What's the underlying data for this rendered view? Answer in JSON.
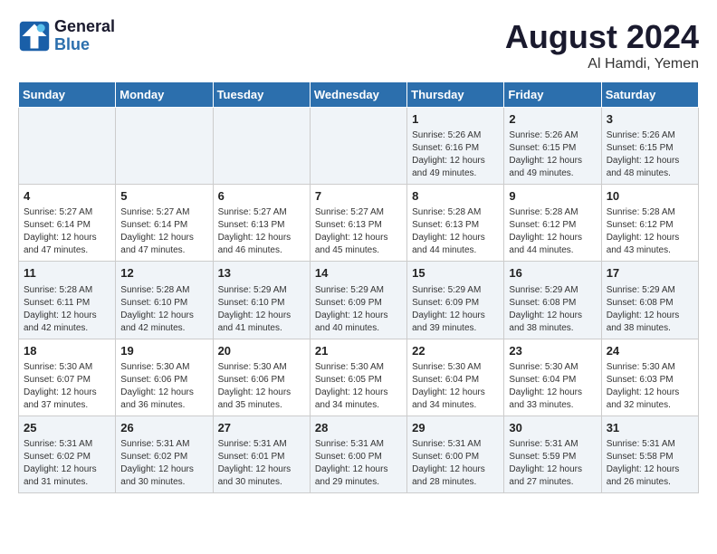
{
  "header": {
    "logo_line1": "General",
    "logo_line2": "Blue",
    "month_year": "August 2024",
    "location": "Al Hamdi, Yemen"
  },
  "days_of_week": [
    "Sunday",
    "Monday",
    "Tuesday",
    "Wednesday",
    "Thursday",
    "Friday",
    "Saturday"
  ],
  "weeks": [
    [
      {
        "day": "",
        "content": ""
      },
      {
        "day": "",
        "content": ""
      },
      {
        "day": "",
        "content": ""
      },
      {
        "day": "",
        "content": ""
      },
      {
        "day": "1",
        "content": "Sunrise: 5:26 AM\nSunset: 6:16 PM\nDaylight: 12 hours\nand 49 minutes."
      },
      {
        "day": "2",
        "content": "Sunrise: 5:26 AM\nSunset: 6:15 PM\nDaylight: 12 hours\nand 49 minutes."
      },
      {
        "day": "3",
        "content": "Sunrise: 5:26 AM\nSunset: 6:15 PM\nDaylight: 12 hours\nand 48 minutes."
      }
    ],
    [
      {
        "day": "4",
        "content": "Sunrise: 5:27 AM\nSunset: 6:14 PM\nDaylight: 12 hours\nand 47 minutes."
      },
      {
        "day": "5",
        "content": "Sunrise: 5:27 AM\nSunset: 6:14 PM\nDaylight: 12 hours\nand 47 minutes."
      },
      {
        "day": "6",
        "content": "Sunrise: 5:27 AM\nSunset: 6:13 PM\nDaylight: 12 hours\nand 46 minutes."
      },
      {
        "day": "7",
        "content": "Sunrise: 5:27 AM\nSunset: 6:13 PM\nDaylight: 12 hours\nand 45 minutes."
      },
      {
        "day": "8",
        "content": "Sunrise: 5:28 AM\nSunset: 6:13 PM\nDaylight: 12 hours\nand 44 minutes."
      },
      {
        "day": "9",
        "content": "Sunrise: 5:28 AM\nSunset: 6:12 PM\nDaylight: 12 hours\nand 44 minutes."
      },
      {
        "day": "10",
        "content": "Sunrise: 5:28 AM\nSunset: 6:12 PM\nDaylight: 12 hours\nand 43 minutes."
      }
    ],
    [
      {
        "day": "11",
        "content": "Sunrise: 5:28 AM\nSunset: 6:11 PM\nDaylight: 12 hours\nand 42 minutes."
      },
      {
        "day": "12",
        "content": "Sunrise: 5:28 AM\nSunset: 6:10 PM\nDaylight: 12 hours\nand 42 minutes."
      },
      {
        "day": "13",
        "content": "Sunrise: 5:29 AM\nSunset: 6:10 PM\nDaylight: 12 hours\nand 41 minutes."
      },
      {
        "day": "14",
        "content": "Sunrise: 5:29 AM\nSunset: 6:09 PM\nDaylight: 12 hours\nand 40 minutes."
      },
      {
        "day": "15",
        "content": "Sunrise: 5:29 AM\nSunset: 6:09 PM\nDaylight: 12 hours\nand 39 minutes."
      },
      {
        "day": "16",
        "content": "Sunrise: 5:29 AM\nSunset: 6:08 PM\nDaylight: 12 hours\nand 38 minutes."
      },
      {
        "day": "17",
        "content": "Sunrise: 5:29 AM\nSunset: 6:08 PM\nDaylight: 12 hours\nand 38 minutes."
      }
    ],
    [
      {
        "day": "18",
        "content": "Sunrise: 5:30 AM\nSunset: 6:07 PM\nDaylight: 12 hours\nand 37 minutes."
      },
      {
        "day": "19",
        "content": "Sunrise: 5:30 AM\nSunset: 6:06 PM\nDaylight: 12 hours\nand 36 minutes."
      },
      {
        "day": "20",
        "content": "Sunrise: 5:30 AM\nSunset: 6:06 PM\nDaylight: 12 hours\nand 35 minutes."
      },
      {
        "day": "21",
        "content": "Sunrise: 5:30 AM\nSunset: 6:05 PM\nDaylight: 12 hours\nand 34 minutes."
      },
      {
        "day": "22",
        "content": "Sunrise: 5:30 AM\nSunset: 6:04 PM\nDaylight: 12 hours\nand 34 minutes."
      },
      {
        "day": "23",
        "content": "Sunrise: 5:30 AM\nSunset: 6:04 PM\nDaylight: 12 hours\nand 33 minutes."
      },
      {
        "day": "24",
        "content": "Sunrise: 5:30 AM\nSunset: 6:03 PM\nDaylight: 12 hours\nand 32 minutes."
      }
    ],
    [
      {
        "day": "25",
        "content": "Sunrise: 5:31 AM\nSunset: 6:02 PM\nDaylight: 12 hours\nand 31 minutes."
      },
      {
        "day": "26",
        "content": "Sunrise: 5:31 AM\nSunset: 6:02 PM\nDaylight: 12 hours\nand 30 minutes."
      },
      {
        "day": "27",
        "content": "Sunrise: 5:31 AM\nSunset: 6:01 PM\nDaylight: 12 hours\nand 30 minutes."
      },
      {
        "day": "28",
        "content": "Sunrise: 5:31 AM\nSunset: 6:00 PM\nDaylight: 12 hours\nand 29 minutes."
      },
      {
        "day": "29",
        "content": "Sunrise: 5:31 AM\nSunset: 6:00 PM\nDaylight: 12 hours\nand 28 minutes."
      },
      {
        "day": "30",
        "content": "Sunrise: 5:31 AM\nSunset: 5:59 PM\nDaylight: 12 hours\nand 27 minutes."
      },
      {
        "day": "31",
        "content": "Sunrise: 5:31 AM\nSunset: 5:58 PM\nDaylight: 12 hours\nand 26 minutes."
      }
    ]
  ]
}
